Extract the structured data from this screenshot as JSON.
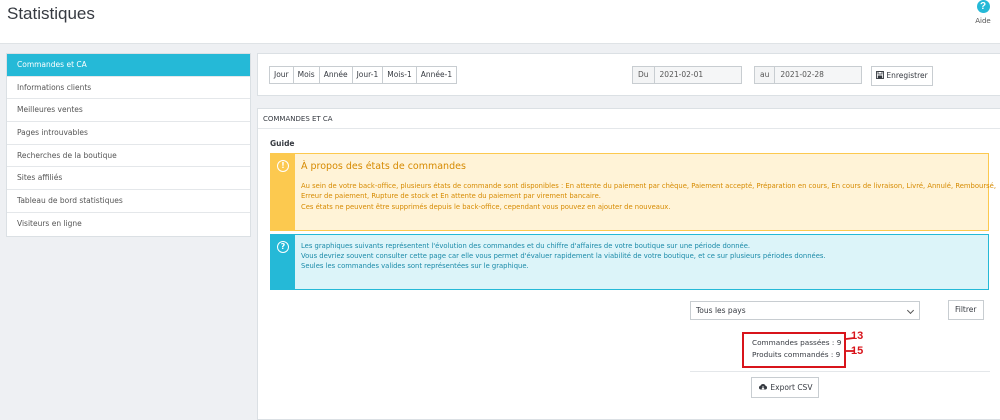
{
  "header": {
    "title": "Statistiques",
    "help_label": "Aide",
    "help_icon": "?"
  },
  "sidebar": {
    "items": [
      {
        "label": "Commandes et CA",
        "active": true
      },
      {
        "label": "Informations clients"
      },
      {
        "label": "Meilleures ventes"
      },
      {
        "label": "Pages introuvables"
      },
      {
        "label": "Recherches de la boutique"
      },
      {
        "label": "Sites affiliés"
      },
      {
        "label": "Tableau de bord statistiques"
      },
      {
        "label": "Visiteurs en ligne"
      }
    ]
  },
  "period": {
    "buttons": [
      "Jour",
      "Mois",
      "Année",
      "Jour-1",
      "Mois-1",
      "Année-1"
    ],
    "from_label": "Du",
    "from_value": "2021-02-01",
    "to_label": "au",
    "to_value": "2021-02-28",
    "save_label": "Enregistrer"
  },
  "main": {
    "heading": "COMMANDES ET CA",
    "guide_label": "Guide",
    "warning": {
      "title": "À propos des états de commandes",
      "lines": [
        "Au sein de votre back-office, plusieurs états de commande sont disponibles : En attente du paiement par chèque, Paiement accepté, Préparation en cours, En cours de livraison, Livré, Annulé, Remboursé,",
        "Erreur de paiement, Rupture de stock et En attente du paiement par virement bancaire.",
        "Ces états ne peuvent être supprimés depuis le back-office, cependant vous pouvez en ajouter de nouveaux."
      ]
    },
    "info": {
      "lines": [
        "Les graphiques suivants représentent l'évolution des commandes et du chiffre d'affaires de votre boutique sur une période donnée.",
        "Vous devriez souvent consulter cette page car elle vous permet d'évaluer rapidement la viabilité de votre boutique, et ce sur plusieurs périodes données.",
        "Seules les commandes valides sont représentées sur le graphique."
      ]
    },
    "country_select": "Tous les pays",
    "filter_label": "Filtrer",
    "stats": {
      "orders": "Commandes passées : 9",
      "products": "Produits commandés : 9"
    },
    "annotations": {
      "orders_note": "13",
      "products_note": "15"
    },
    "export_label": "Export CSV"
  },
  "colors": {
    "accent": "#25b9d7",
    "warning_bg": "#fff3d7",
    "warning_border": "#fcc94f",
    "annotation": "#d8141b"
  }
}
